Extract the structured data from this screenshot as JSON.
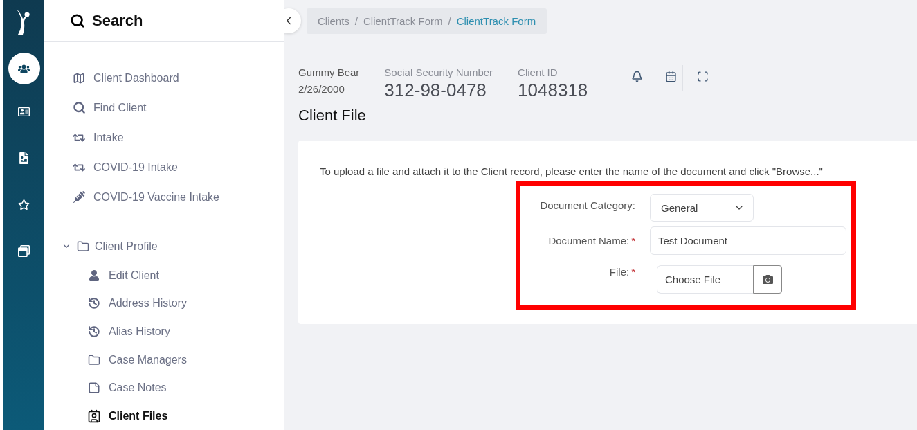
{
  "rail": {
    "items": [
      {
        "kind": "people",
        "selected": true
      },
      {
        "kind": "id-card",
        "selected": false
      },
      {
        "kind": "document",
        "selected": false
      },
      {
        "kind": "star",
        "selected": false
      },
      {
        "kind": "windows",
        "selected": false
      }
    ]
  },
  "sidebar": {
    "title": "Search",
    "items": [
      {
        "label": "Client Dashboard",
        "kind": "map"
      },
      {
        "label": "Find Client",
        "kind": "search"
      },
      {
        "label": "Intake",
        "kind": "repeat"
      },
      {
        "label": "COVID-19 Intake",
        "kind": "repeat"
      },
      {
        "label": "COVID-19 Vaccine Intake",
        "kind": "syringe"
      }
    ],
    "group": {
      "label": "Client Profile",
      "expanded": true,
      "children": [
        {
          "label": "Edit Client",
          "kind": "user",
          "selected": false
        },
        {
          "label": "Address History",
          "kind": "history",
          "selected": false
        },
        {
          "label": "Alias History",
          "kind": "history",
          "selected": false
        },
        {
          "label": "Case Managers",
          "kind": "folder",
          "selected": false
        },
        {
          "label": "Case Notes",
          "kind": "note",
          "selected": false
        },
        {
          "label": "Client Files",
          "kind": "contact",
          "selected": true
        }
      ]
    }
  },
  "breadcrumb": {
    "separator": "/",
    "items": [
      {
        "label": "Clients",
        "selected": false
      },
      {
        "label": "ClientTrack Form",
        "selected": false
      },
      {
        "label": "ClientTrack Form",
        "selected": true
      }
    ]
  },
  "client": {
    "name": "Gummy Bear",
    "dob": "2/26/2000",
    "ssn_label": "Social Security Number",
    "ssn": "312-98-0478",
    "id_label": "Client ID",
    "id": "1048318"
  },
  "page_title": "Client File",
  "form": {
    "instruction": "To upload a file and attach it to the Client record, please enter the name of the document and click \"Browse...\"",
    "required_mark": "*",
    "fields": [
      {
        "kind": "select",
        "label": "Document Category:",
        "required": false,
        "value": "General"
      },
      {
        "kind": "text",
        "label": "Document Name:",
        "required": true,
        "value": "Test Document"
      },
      {
        "kind": "file",
        "label": "File:",
        "required": true,
        "value": "Choose File"
      }
    ]
  }
}
